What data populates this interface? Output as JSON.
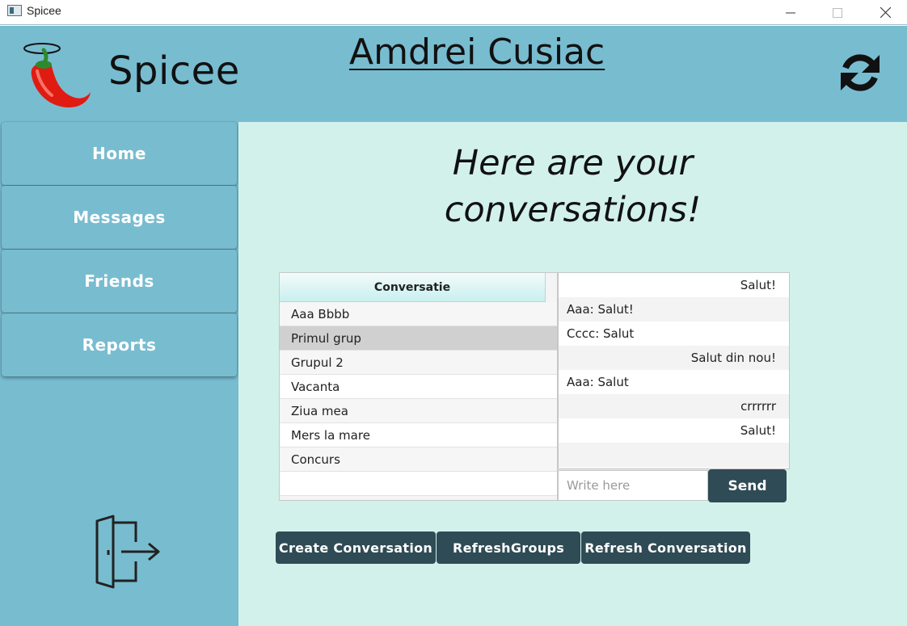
{
  "window": {
    "title": "Spicee"
  },
  "header": {
    "brand": "Spicee",
    "username": "Amdrei Cusiac",
    "refresh_icon": "refresh-icon",
    "logo_icon": "chili-pepper-logo"
  },
  "sidebar": {
    "items": [
      {
        "label": "Home"
      },
      {
        "label": "Messages"
      },
      {
        "label": "Friends"
      },
      {
        "label": "Reports"
      }
    ],
    "logout_icon": "logout-door-icon"
  },
  "main": {
    "heading_line1": "Here are your",
    "heading_line2": "conversations!",
    "conversations": {
      "header": "Conversatie",
      "items": [
        "Aaa Bbbb",
        "Primul grup",
        "Grupul 2",
        "Vacanta",
        "Ziua mea",
        "Mers la mare",
        "Concurs"
      ],
      "selected": "Primul grup"
    },
    "messages": [
      {
        "text": "Salut!",
        "align": "right"
      },
      {
        "text": "Aaa:  Salut!",
        "align": "left"
      },
      {
        "text": "Cccc:  Salut",
        "align": "left"
      },
      {
        "text": "Salut din nou!",
        "align": "right"
      },
      {
        "text": "Aaa:  Salut",
        "align": "left"
      },
      {
        "text": "crrrrrr",
        "align": "right"
      },
      {
        "text": "Salut!",
        "align": "right"
      }
    ],
    "input_placeholder": "Write here",
    "send_label": "Send",
    "actions": {
      "create": "Create Conversation",
      "refresh_groups": "RefreshGroups",
      "refresh_conversation": "Refresh Conversation"
    }
  },
  "colors": {
    "header_bg": "#78bcd0",
    "main_bg": "#d2f1eb",
    "button_dark": "#2f4b55"
  }
}
